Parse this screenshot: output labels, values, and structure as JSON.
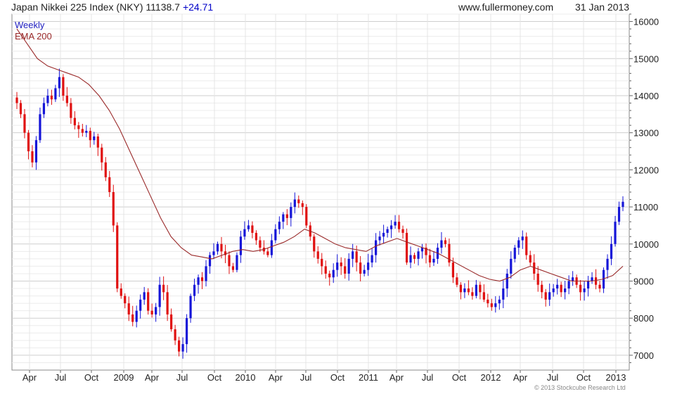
{
  "header": {
    "title": "Japan Nikkei 225 Index (NKY) 11138.7",
    "change": "+24.71",
    "site": "www.fullermoney.com",
    "date": "31 Jan 2013"
  },
  "legend": {
    "weekly": "Weekly",
    "ema": "EMA 200"
  },
  "copyright": "© 2013 Stockcube Research Ltd",
  "colors": {
    "up": "#1515d8",
    "down": "#e01010",
    "ema": "#9a2a2a",
    "grid": "#dcdcdc"
  },
  "chart_data": {
    "type": "candlestick",
    "title": "Japan Nikkei 225 Index (NKY) 11138.7 +24.71",
    "interval": "Weekly",
    "ylim": [
      6600,
      16200
    ],
    "yticks": [
      7000,
      8000,
      9000,
      10000,
      11000,
      12000,
      13000,
      14000,
      15000,
      16000
    ],
    "grid": true,
    "legend_position": "top-left",
    "x_tick_labels": [
      "Apr",
      "Jul",
      "Oct",
      "2009",
      "Apr",
      "Jul",
      "Oct",
      "2010",
      "Apr",
      "Jul",
      "Oct",
      "2011",
      "Apr",
      "Jul",
      "Oct",
      "2012",
      "Apr",
      "Jul",
      "Oct",
      "2013"
    ],
    "series": [
      {
        "name": "Weekly",
        "kind": "close_path",
        "values": [
          13800,
          13500,
          13000,
          12500,
          12200,
          12800,
          13500,
          13800,
          14000,
          13900,
          14200,
          14500,
          14000,
          13800,
          13400,
          13200,
          13100,
          13000,
          13050,
          12800,
          12900,
          12600,
          12200,
          11800,
          11400,
          10500,
          8800,
          8600,
          8400,
          8100,
          7900,
          8200,
          8500,
          8700,
          8200,
          8100,
          8300,
          8900,
          8700,
          8100,
          7700,
          7400,
          7100,
          7300,
          8000,
          8600,
          8900,
          9100,
          9000,
          9400,
          9700,
          9800,
          10000,
          9800,
          9700,
          9400,
          9300,
          9700,
          10200,
          10400,
          10500,
          10300,
          10100,
          9900,
          9800,
          9700,
          10100,
          10400,
          10600,
          10800,
          10700,
          11000,
          11200,
          11100,
          11000,
          10500,
          10200,
          9800,
          9600,
          9400,
          9200,
          9100,
          9300,
          9500,
          9400,
          9200,
          9600,
          9800,
          9500,
          9200,
          9300,
          9500,
          9700,
          10100,
          10200,
          10300,
          10400,
          10500,
          10600,
          10400,
          10300,
          9500,
          9700,
          9600,
          9800,
          9900,
          9700,
          9500,
          9600,
          9900,
          10100,
          10000,
          9500,
          9100,
          8900,
          8700,
          8800,
          8700,
          8600,
          8900,
          8700,
          8500,
          8400,
          8300,
          8400,
          8500,
          8800,
          9200,
          9600,
          9900,
          10100,
          10200,
          9700,
          9500,
          9200,
          8900,
          8700,
          8500,
          8700,
          8800,
          8900,
          8700,
          8800,
          9000,
          9100,
          8900,
          8700,
          8800,
          9000,
          9100,
          8900,
          8800,
          9300,
          9600,
          10000,
          10600,
          11000,
          11138.7
        ]
      },
      {
        "name": "EMA 200",
        "kind": "line",
        "values": [
          15800,
          15400,
          15000,
          14800,
          14700,
          14600,
          14500,
          14300,
          14000,
          13600,
          13100,
          12500,
          11900,
          11300,
          10700,
          10200,
          9900,
          9700,
          9650,
          9600,
          9700,
          9800,
          9850,
          9800,
          9850,
          9950,
          10050,
          10200,
          10400,
          10300,
          10150,
          10000,
          9900,
          9850,
          9800,
          9950,
          10050,
          10150,
          10050,
          9950,
          9850,
          9750,
          9600,
          9450,
          9300,
          9150,
          9050,
          9000,
          9100,
          9300,
          9400,
          9300,
          9200,
          9100,
          9000,
          9000,
          9000,
          9050,
          9150,
          9400
        ]
      }
    ]
  }
}
